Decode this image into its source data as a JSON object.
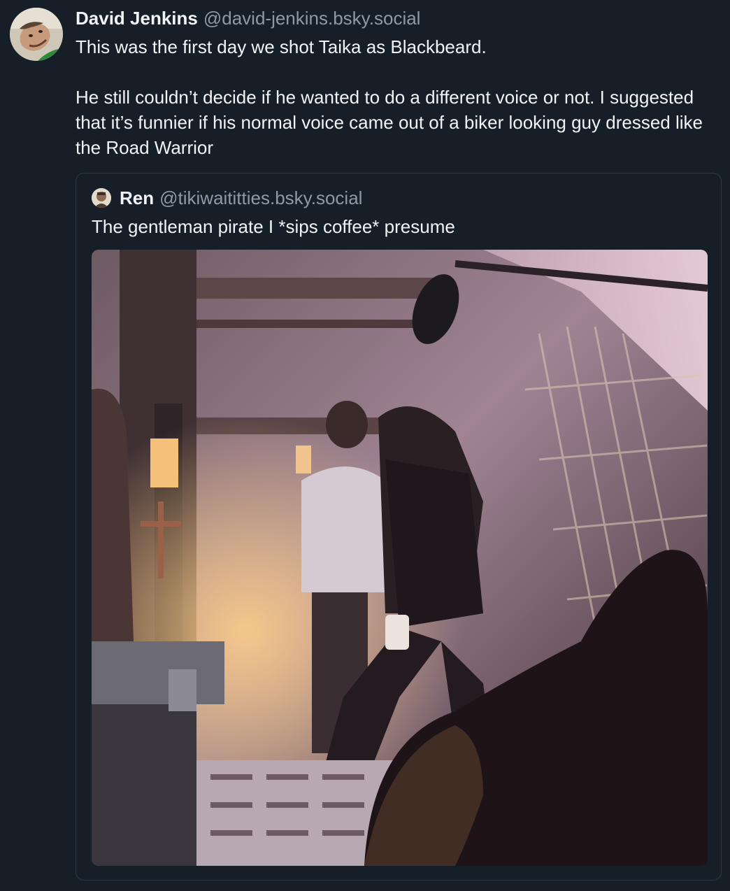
{
  "post": {
    "author": {
      "display_name": "David Jenkins",
      "handle": "@david-jenkins.bsky.social"
    },
    "text_paragraphs": [
      "This was the first day we shot Taika as Blackbeard.",
      "He still couldn’t decide if he wanted to do a different voice or not. I suggested that it’s funnier if his normal voice came out of a biker looking guy dressed like the Road Warrior"
    ],
    "quote": {
      "author": {
        "display_name": "Ren",
        "handle": "@tikiwaititties.bsky.social"
      },
      "text": "The gentleman pirate I *sips coffee* presume"
    }
  },
  "colors": {
    "background": "#161e27",
    "text_primary": "#f1f3f5",
    "text_secondary": "#8d9aa8",
    "border": "#2e3a48"
  }
}
